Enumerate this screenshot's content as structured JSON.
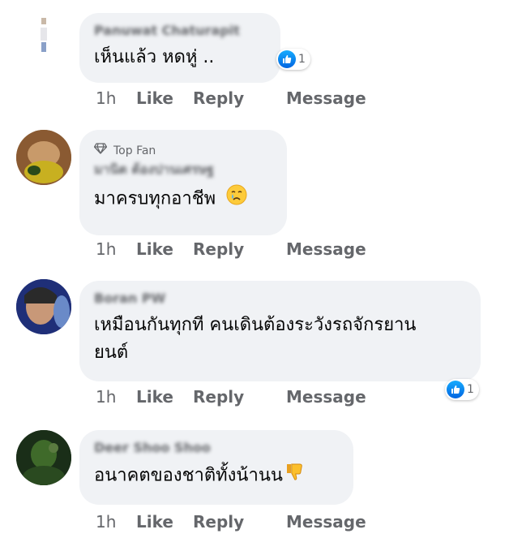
{
  "comments": [
    {
      "author": "Panuwat Chaturapit",
      "text": "เห็นแล้ว หดหู่ ..",
      "time": "1h",
      "like": "Like",
      "reply": "Reply",
      "message": "Message",
      "reaction_count": "1"
    },
    {
      "badge": "Top Fan",
      "author": "มานิต ต้องปานเศรษฐ",
      "text": "มาครบทุกอาชีพ",
      "emoji": "crying-face",
      "time": "1h",
      "like": "Like",
      "reply": "Reply",
      "message": "Message"
    },
    {
      "author": "Boran PW",
      "text_line1": "เหมือนกันทุกที คนเดินต้องระวังรถจักรยาน",
      "text_line2": "ยนต์",
      "time": "1h",
      "like": "Like",
      "reply": "Reply",
      "message": "Message",
      "reaction_count": "1"
    },
    {
      "author": "Deer Shoo Shoo",
      "text": "อนาคตของชาติทั้งน้านน",
      "emoji": "thumbs-down",
      "time": "1h",
      "like": "Like",
      "reply": "Reply",
      "message": "Message"
    }
  ],
  "colors": {
    "bubble": "#f0f2f5",
    "meta": "#65676b",
    "like_blue": "#0866ff"
  }
}
